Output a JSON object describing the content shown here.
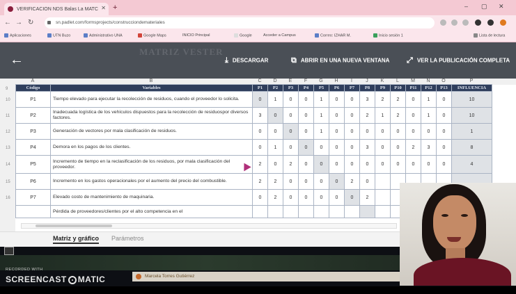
{
  "browser": {
    "tab_title": "VERIFICACION NDS Balas La MATC",
    "url": "sn.padlet.com/formsprojects/construcciondemateriales",
    "bookmarks": [
      "Aplicaciones",
      "UTN Buzo",
      "Administrativo UNA",
      "Google Maps",
      "INICIO Principal",
      "Google",
      "Acceder a Campus",
      "Correo: IZHAR M.",
      "Inicio sesión 1",
      "Lista de lectura"
    ]
  },
  "toolbar": {
    "ghost_title": "MATRIZ VESTER",
    "download_label": "DESCARGAR",
    "open_new_window_label": "ABRIR EN UNA NUEVA VENTANA",
    "view_full_label": "VER LA PUBLICACIÓN COMPLETA"
  },
  "sheet": {
    "column_letters": [
      "A",
      "B",
      "C",
      "D",
      "E",
      "F",
      "G",
      "H",
      "I",
      "J",
      "K",
      "L",
      "M",
      "N",
      "O",
      "P"
    ],
    "row_numbers": [
      "9",
      "10",
      "11",
      "12",
      "13",
      "14",
      "15",
      "16"
    ],
    "header": {
      "code": "Código",
      "variable": "Variables",
      "p_cols": [
        "P1",
        "P2",
        "P3",
        "P4",
        "P5",
        "P6",
        "P7",
        "P8",
        "P9",
        "P10",
        "P11",
        "P12",
        "P13"
      ],
      "influence": "INFLUENCIA"
    },
    "rows": [
      {
        "code": "P1",
        "variable": "Tiempo elevado para ejecutar la recolección de residuos, cuando el proveedor lo solicita.",
        "values": [
          "0",
          "1",
          "0",
          "0",
          "1",
          "0",
          "0",
          "3",
          "2",
          "2",
          "0",
          "1",
          "0"
        ],
        "influence": "10"
      },
      {
        "code": "P2",
        "variable": "Inadecuada logística de los vehículos dispuestos para la recolección de residuospor diversos factores.",
        "values": [
          "3",
          "0",
          "0",
          "0",
          "1",
          "0",
          "0",
          "2",
          "1",
          "2",
          "0",
          "1",
          "0"
        ],
        "influence": "10"
      },
      {
        "code": "P3",
        "variable": "Generación de vectores por mala clasificación de residuos.",
        "values": [
          "0",
          "0",
          "0",
          "0",
          "1",
          "0",
          "0",
          "0",
          "0",
          "0",
          "0",
          "0",
          "0"
        ],
        "influence": "1"
      },
      {
        "code": "P4",
        "variable": "Demora en los pagos de los clientes.",
        "values": [
          "0",
          "1",
          "0",
          "0",
          "0",
          "0",
          "0",
          "3",
          "0",
          "0",
          "2",
          "3",
          "0"
        ],
        "influence": "8"
      },
      {
        "code": "P5",
        "variable": "Incremento de tiempo en la reclasificación de los residuos, por mala clasificación del proveedor.",
        "values": [
          "2",
          "0",
          "2",
          "0",
          "0",
          "0",
          "0",
          "0",
          "0",
          "0",
          "0",
          "0",
          "0"
        ],
        "influence": "4"
      },
      {
        "code": "P6",
        "variable": "Incremento en los gastos operacionales por el aumento del precio del combustible.",
        "values": [
          "2",
          "2",
          "0",
          "0",
          "0",
          "0",
          "2",
          "0",
          "",
          "",
          "",
          "",
          ""
        ],
        "influence": ""
      },
      {
        "code": "P7",
        "variable": "Elevado costo de mantenimiento de maquinaria.",
        "values": [
          "0",
          "2",
          "0",
          "0",
          "0",
          "0",
          "0",
          "2",
          "",
          "",
          "",
          "",
          ""
        ],
        "influence": ""
      },
      {
        "code": "",
        "variable": "Pérdida de proveedores/clientes por el alto competencia en el",
        "values": [
          "",
          "",
          "",
          "",
          "",
          "",
          "",
          "",
          "",
          "",
          "",
          "",
          ""
        ],
        "influence": ""
      }
    ],
    "tab_active": "Matriz y gráfico",
    "tab_other": "Parámetros"
  },
  "recording": {
    "recorded_with": "RECORDED WITH",
    "brand_left": "SCREENCAST",
    "brand_right": "MATIC",
    "author": "Marcela Torres Gutiérrez"
  }
}
